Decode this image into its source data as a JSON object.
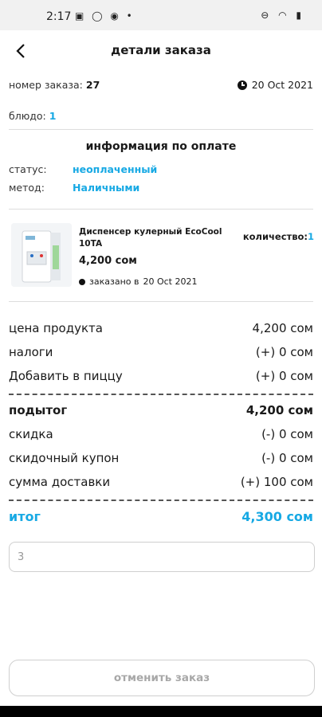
{
  "status_bar": {
    "time": "2:17",
    "left_icons": "▣ ◯ ◉ •",
    "right_icons": "⊖ ◠ ▮"
  },
  "header": {
    "title": "детали заказа"
  },
  "order": {
    "number_label": "номер заказа:",
    "number": "27",
    "date": "20 Oct 2021",
    "dish_label": "блюдо:",
    "dish": "1"
  },
  "payment": {
    "title": "информация по оплате",
    "status_label": "статус:",
    "status": "неоплаченный",
    "method_label": "метод:",
    "method": "Наличными"
  },
  "product": {
    "name": "Диспенсер кулерный EcoCool 10TA",
    "quantity_label": "количество:",
    "quantity": "1",
    "price": "4,200 сом",
    "ordered_label": "заказано в",
    "ordered_date": "20 Oct 2021"
  },
  "summary": {
    "rows1": [
      {
        "label": "цена продукта",
        "value": "4,200 сом"
      },
      {
        "label": "налоги",
        "value": "(+) 0 сом"
      },
      {
        "label": "Добавить в пиццу",
        "value": "(+) 0 сом"
      }
    ],
    "subtotal": {
      "label": "подытог",
      "value": "4,200 сом"
    },
    "rows2": [
      {
        "label": "скидка",
        "value": "(-) 0 сом"
      },
      {
        "label": "скидочный купон",
        "value": "(-) 0 сом"
      },
      {
        "label": "сумма доставки",
        "value": "(+) 100 сом"
      }
    ],
    "total": {
      "label": "итог",
      "value": "4,300 сом"
    }
  },
  "note_input": {
    "value": "3"
  },
  "cancel_button": {
    "label": "отменить заказ"
  },
  "colors": {
    "accent": "#17a9e4"
  },
  "icons": {
    "back": "chevron-left-icon",
    "clock": "clock-icon",
    "dot": "dot-icon"
  }
}
